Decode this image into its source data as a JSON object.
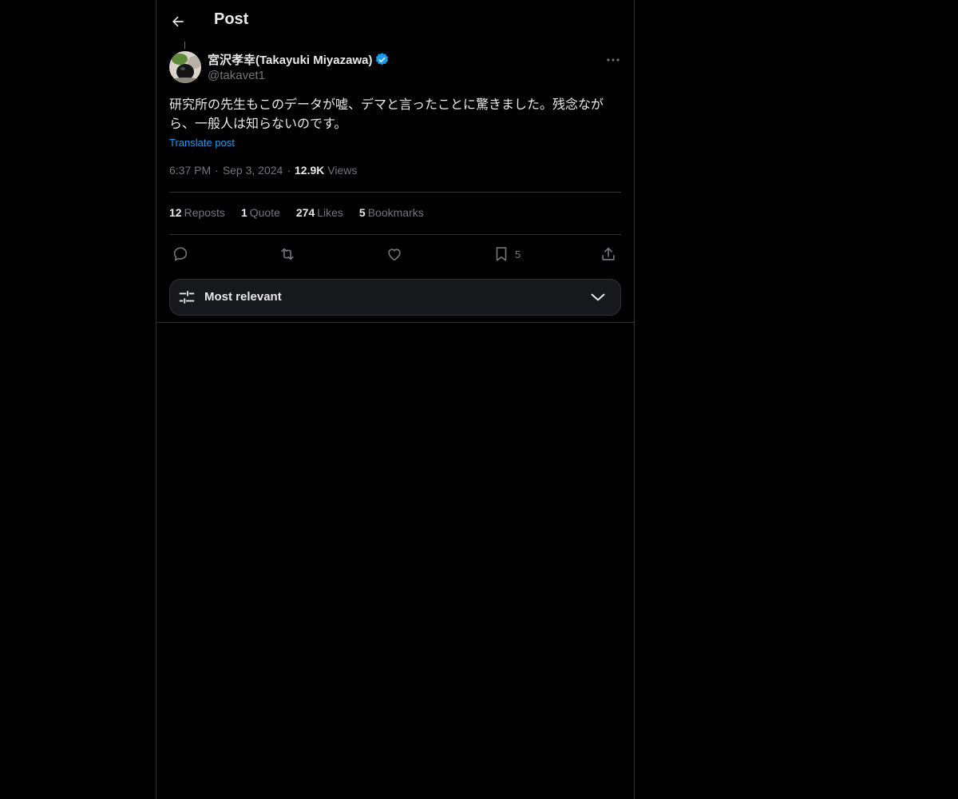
{
  "header": {
    "title": "Post"
  },
  "author": {
    "name": "宮沢孝幸(Takayuki Miyazawa)",
    "handle": "@takavet1"
  },
  "post": {
    "text": "研究所の先生もこのデータが嘘、デマと言ったことに驚きました。残念ながら、一般人は知らないのです。",
    "translate_label": "Translate post",
    "time": "6:37 PM",
    "date": "Sep 3, 2024",
    "views_count": "12.9K",
    "views_label": "Views"
  },
  "stats": {
    "reposts_count": "12",
    "reposts_label": "Reposts",
    "quotes_count": "1",
    "quotes_label": "Quote",
    "likes_count": "274",
    "likes_label": "Likes",
    "bookmarks_count": "5",
    "bookmarks_label": "Bookmarks"
  },
  "actions": {
    "bookmark_count": "5",
    "icons": [
      "reply-icon",
      "repost-icon",
      "like-icon",
      "bookmark-icon",
      "share-icon"
    ]
  },
  "sort": {
    "label": "Most relevant"
  },
  "colors": {
    "background": "#000000",
    "text": "#e7e9ea",
    "muted": "#71767b",
    "accent": "#1d9bf0",
    "border": "#2f3336"
  }
}
